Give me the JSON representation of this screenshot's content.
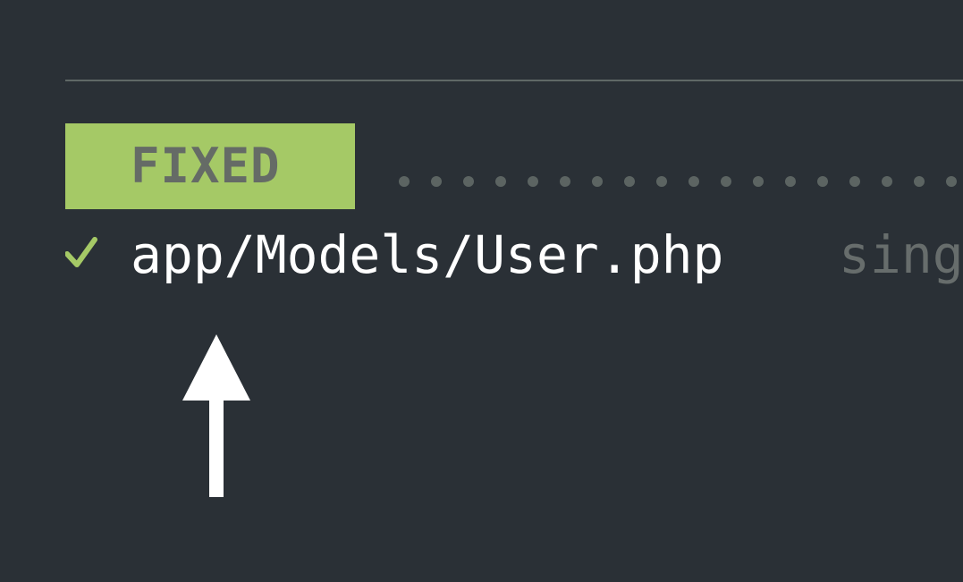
{
  "result": {
    "status_label": "FIXED",
    "status_color": "#a5c966",
    "file_path": "app/Models/User.php",
    "rule_name_partial": "sing",
    "icon": "check-icon"
  },
  "annotation": {
    "icon": "arrow-up-icon"
  }
}
